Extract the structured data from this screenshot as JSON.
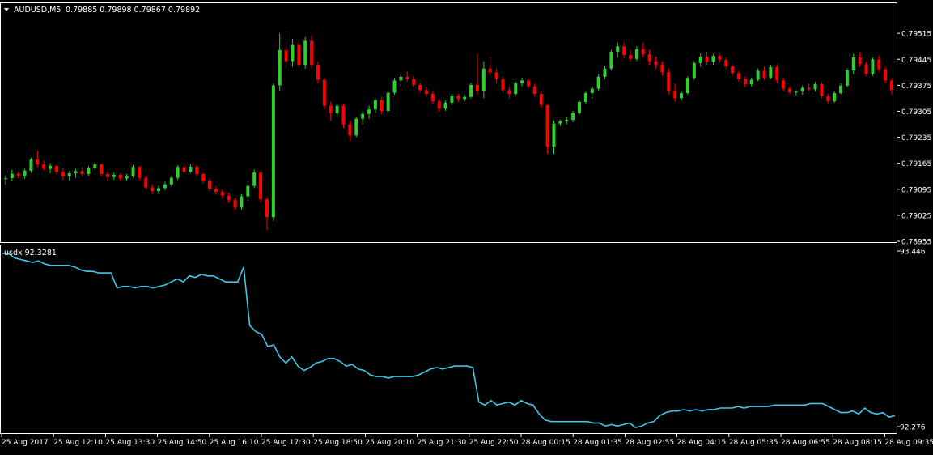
{
  "window": {
    "symbol_label": "AUDUSD,M5",
    "quote_values": "0.79885 0.79898 0.79867 0.79892",
    "indicator_label": "usdx 92.3281",
    "menu_icon": "triangle-down-icon"
  },
  "colors": {
    "background": "#000000",
    "frame": "#ffffff",
    "bull_candle": "#32cd32",
    "bear_candle": "#ff0000",
    "indicator_line": "#40c8e6",
    "text": "#ffffff"
  },
  "chart_data": [
    {
      "type": "candlestick",
      "name": "AUDUSD,M5",
      "y_ticks": [
        "0.79515",
        "0.79445",
        "0.79375",
        "0.79305",
        "0.79235",
        "0.79165",
        "0.79095",
        "0.79025",
        "0.78955"
      ],
      "ylim": [
        0.78955,
        0.79535
      ],
      "grid": false,
      "ohlc": [
        [
          0.79124,
          0.79132,
          0.79108,
          0.79125
        ],
        [
          0.79125,
          0.79148,
          0.79118,
          0.79137
        ],
        [
          0.79137,
          0.79142,
          0.79125,
          0.79131
        ],
        [
          0.79131,
          0.7915,
          0.79124,
          0.79145
        ],
        [
          0.79145,
          0.7918,
          0.7914,
          0.79175
        ],
        [
          0.79175,
          0.79198,
          0.79155,
          0.79162
        ],
        [
          0.79162,
          0.79172,
          0.79145,
          0.7915
        ],
        [
          0.7915,
          0.79165,
          0.79138,
          0.79158
        ],
        [
          0.79158,
          0.7916,
          0.79136,
          0.79142
        ],
        [
          0.79142,
          0.79152,
          0.7912,
          0.7913
        ],
        [
          0.7913,
          0.79144,
          0.79118,
          0.79138
        ],
        [
          0.79138,
          0.7915,
          0.79126,
          0.79144
        ],
        [
          0.79144,
          0.79154,
          0.7913,
          0.79136
        ],
        [
          0.79136,
          0.79158,
          0.7913,
          0.79152
        ],
        [
          0.79152,
          0.79168,
          0.79146,
          0.79162
        ],
        [
          0.79162,
          0.79166,
          0.7913,
          0.79136
        ],
        [
          0.79136,
          0.79142,
          0.79116,
          0.79128
        ],
        [
          0.79128,
          0.7914,
          0.7912,
          0.79134
        ],
        [
          0.79134,
          0.79138,
          0.79118,
          0.79124
        ],
        [
          0.79124,
          0.79136,
          0.79118,
          0.7913
        ],
        [
          0.7913,
          0.7916,
          0.79126,
          0.79155
        ],
        [
          0.79155,
          0.79158,
          0.7912,
          0.79126
        ],
        [
          0.79126,
          0.7913,
          0.79095,
          0.791
        ],
        [
          0.791,
          0.79108,
          0.79082,
          0.7909
        ],
        [
          0.7909,
          0.79105,
          0.79082,
          0.79098
        ],
        [
          0.79098,
          0.79115,
          0.79092,
          0.79108
        ],
        [
          0.79108,
          0.7913,
          0.79102,
          0.79126
        ],
        [
          0.79126,
          0.7916,
          0.7912,
          0.79155
        ],
        [
          0.79155,
          0.79168,
          0.79135,
          0.79142
        ],
        [
          0.79142,
          0.79162,
          0.79138,
          0.79156
        ],
        [
          0.79156,
          0.7916,
          0.7913,
          0.79136
        ],
        [
          0.79136,
          0.7914,
          0.7911,
          0.79118
        ],
        [
          0.79118,
          0.79124,
          0.7909,
          0.79096
        ],
        [
          0.79096,
          0.79104,
          0.7908,
          0.79088
        ],
        [
          0.79088,
          0.79094,
          0.7907,
          0.79078
        ],
        [
          0.79078,
          0.79086,
          0.79058,
          0.79066
        ],
        [
          0.79066,
          0.79072,
          0.7904,
          0.79046
        ],
        [
          0.79046,
          0.79082,
          0.7904,
          0.79076
        ],
        [
          0.79076,
          0.7911,
          0.7907,
          0.79104
        ],
        [
          0.79104,
          0.79148,
          0.79098,
          0.7914
        ],
        [
          0.7914,
          0.79145,
          0.7906,
          0.79068
        ],
        [
          0.79068,
          0.79074,
          0.78985,
          0.7902
        ],
        [
          0.7902,
          0.7938,
          0.7901,
          0.79375
        ],
        [
          0.79375,
          0.79515,
          0.7936,
          0.7947
        ],
        [
          0.7947,
          0.7952,
          0.7942,
          0.7944
        ],
        [
          0.7944,
          0.795,
          0.79425,
          0.79485
        ],
        [
          0.79485,
          0.795,
          0.7942,
          0.7943
        ],
        [
          0.7943,
          0.79505,
          0.7942,
          0.79495
        ],
        [
          0.79495,
          0.7951,
          0.7942,
          0.7943
        ],
        [
          0.7943,
          0.7944,
          0.7938,
          0.7939
        ],
        [
          0.7939,
          0.79395,
          0.7931,
          0.7932
        ],
        [
          0.7932,
          0.7933,
          0.7928,
          0.793
        ],
        [
          0.793,
          0.79325,
          0.7929,
          0.7932
        ],
        [
          0.7932,
          0.79325,
          0.7926,
          0.7927
        ],
        [
          0.7927,
          0.7928,
          0.79225,
          0.7924
        ],
        [
          0.7924,
          0.7929,
          0.79236,
          0.79285
        ],
        [
          0.79285,
          0.79305,
          0.7927,
          0.79298
        ],
        [
          0.79298,
          0.7932,
          0.79285,
          0.7931
        ],
        [
          0.7931,
          0.7934,
          0.793,
          0.79335
        ],
        [
          0.79335,
          0.79345,
          0.79296,
          0.79306
        ],
        [
          0.79306,
          0.7936,
          0.793,
          0.79355
        ],
        [
          0.79355,
          0.79395,
          0.7935,
          0.79388
        ],
        [
          0.79388,
          0.79405,
          0.79372,
          0.79398
        ],
        [
          0.79398,
          0.79412,
          0.79385,
          0.79392
        ],
        [
          0.79392,
          0.794,
          0.7937,
          0.79376
        ],
        [
          0.79376,
          0.79382,
          0.79355,
          0.79362
        ],
        [
          0.79362,
          0.7937,
          0.79345,
          0.79352
        ],
        [
          0.79352,
          0.79358,
          0.79325,
          0.79332
        ],
        [
          0.79332,
          0.79338,
          0.79305,
          0.79312
        ],
        [
          0.79312,
          0.79334,
          0.79306,
          0.79328
        ],
        [
          0.79328,
          0.79352,
          0.79322,
          0.79346
        ],
        [
          0.79346,
          0.79352,
          0.7933,
          0.79338
        ],
        [
          0.79338,
          0.7935,
          0.79332,
          0.79344
        ],
        [
          0.79344,
          0.79382,
          0.7934,
          0.79376
        ],
        [
          0.79376,
          0.7946,
          0.7935,
          0.7936
        ],
        [
          0.7936,
          0.7944,
          0.7934,
          0.7942
        ],
        [
          0.7942,
          0.7945,
          0.794,
          0.7941
        ],
        [
          0.7941,
          0.7942,
          0.7938,
          0.79392
        ],
        [
          0.79392,
          0.79398,
          0.79355,
          0.79362
        ],
        [
          0.79362,
          0.79372,
          0.7934,
          0.79352
        ],
        [
          0.79352,
          0.79385,
          0.79348,
          0.7938
        ],
        [
          0.7938,
          0.79395,
          0.79372,
          0.79388
        ],
        [
          0.79388,
          0.79394,
          0.79366,
          0.79372
        ],
        [
          0.79372,
          0.7938,
          0.79345,
          0.79352
        ],
        [
          0.79352,
          0.79358,
          0.79315,
          0.79322
        ],
        [
          0.79322,
          0.7927,
          0.7919,
          0.7921
        ],
        [
          0.7921,
          0.7928,
          0.7919,
          0.79272
        ],
        [
          0.79272,
          0.79282,
          0.79266,
          0.79278
        ],
        [
          0.79278,
          0.7929,
          0.7927,
          0.79282
        ],
        [
          0.79282,
          0.79306,
          0.79276,
          0.793
        ],
        [
          0.793,
          0.79335,
          0.79296,
          0.7933
        ],
        [
          0.7933,
          0.7936,
          0.79326,
          0.79354
        ],
        [
          0.79354,
          0.79372,
          0.7934,
          0.79366
        ],
        [
          0.79366,
          0.79405,
          0.7936,
          0.79398
        ],
        [
          0.79398,
          0.79428,
          0.79392,
          0.7942
        ],
        [
          0.7942,
          0.7947,
          0.79415,
          0.79465
        ],
        [
          0.79465,
          0.7949,
          0.7945,
          0.7948
        ],
        [
          0.7948,
          0.7949,
          0.79448,
          0.79456
        ],
        [
          0.79456,
          0.7947,
          0.7944,
          0.79446
        ],
        [
          0.79446,
          0.7948,
          0.7944,
          0.79472
        ],
        [
          0.79472,
          0.7949,
          0.7945,
          0.79458
        ],
        [
          0.79458,
          0.7947,
          0.7943,
          0.7944
        ],
        [
          0.7944,
          0.79452,
          0.7942,
          0.7943
        ],
        [
          0.7943,
          0.7944,
          0.794,
          0.7941
        ],
        [
          0.7941,
          0.7942,
          0.7935,
          0.7936
        ],
        [
          0.7936,
          0.7938,
          0.7933,
          0.7934
        ],
        [
          0.7934,
          0.7936,
          0.79334,
          0.79354
        ],
        [
          0.79354,
          0.794,
          0.7935,
          0.79395
        ],
        [
          0.79395,
          0.7944,
          0.7939,
          0.79435
        ],
        [
          0.79435,
          0.7946,
          0.79425,
          0.79452
        ],
        [
          0.79452,
          0.79465,
          0.7943,
          0.79438
        ],
        [
          0.79438,
          0.7946,
          0.7943,
          0.79454
        ],
        [
          0.79454,
          0.79462,
          0.79436,
          0.79444
        ],
        [
          0.79444,
          0.7945,
          0.7942,
          0.79426
        ],
        [
          0.79426,
          0.79432,
          0.794,
          0.79408
        ],
        [
          0.79408,
          0.79414,
          0.79385,
          0.79392
        ],
        [
          0.79392,
          0.79398,
          0.7937,
          0.79378
        ],
        [
          0.79378,
          0.79396,
          0.79372,
          0.7939
        ],
        [
          0.7939,
          0.7942,
          0.79386,
          0.79414
        ],
        [
          0.79414,
          0.79425,
          0.7939,
          0.79396
        ],
        [
          0.79396,
          0.7943,
          0.79392,
          0.79424
        ],
        [
          0.79424,
          0.79432,
          0.7938,
          0.79388
        ],
        [
          0.79388,
          0.79395,
          0.7936,
          0.79366
        ],
        [
          0.79366,
          0.79372,
          0.7935,
          0.79356
        ],
        [
          0.79356,
          0.79362,
          0.79348,
          0.79358
        ],
        [
          0.79358,
          0.79374,
          0.7935,
          0.79368
        ],
        [
          0.79368,
          0.7938,
          0.79358,
          0.79364
        ],
        [
          0.79364,
          0.79384,
          0.79358,
          0.79378
        ],
        [
          0.79378,
          0.79384,
          0.7934,
          0.79346
        ],
        [
          0.79346,
          0.79352,
          0.79325,
          0.79332
        ],
        [
          0.79332,
          0.7936,
          0.79328,
          0.79354
        ],
        [
          0.79354,
          0.7938,
          0.7935,
          0.79374
        ],
        [
          0.79374,
          0.7942,
          0.7937,
          0.79415
        ],
        [
          0.79415,
          0.7946,
          0.79405,
          0.7945
        ],
        [
          0.7945,
          0.79465,
          0.79425,
          0.79432
        ],
        [
          0.79432,
          0.79438,
          0.794,
          0.79406
        ],
        [
          0.79406,
          0.7945,
          0.794,
          0.79445
        ],
        [
          0.79445,
          0.79455,
          0.7941,
          0.79418
        ],
        [
          0.79418,
          0.79425,
          0.7938,
          0.79388
        ],
        [
          0.79388,
          0.79394,
          0.7935,
          0.79362
        ]
      ]
    },
    {
      "type": "line",
      "name": "usdx",
      "ylim": [
        92.276,
        93.446
      ],
      "y_ticks": [
        "93.446",
        "92.276"
      ],
      "x_ticks": [
        "25 Aug 2017",
        "25 Aug 12:10",
        "25 Aug 13:30",
        "25 Aug 14:50",
        "25 Aug 16:10",
        "25 Aug 17:30",
        "25 Aug 18:50",
        "25 Aug 20:10",
        "25 Aug 21:30",
        "25 Aug 22:50",
        "28 Aug 00:15",
        "28 Aug 01:35",
        "28 Aug 02:55",
        "28 Aug 04:15",
        "28 Aug 05:35",
        "28 Aug 06:55",
        "28 Aug 08:15",
        "28 Aug 09:35"
      ],
      "grid": false,
      "values": [
        93.43,
        93.43,
        93.4,
        93.39,
        93.38,
        93.37,
        93.38,
        93.36,
        93.35,
        93.35,
        93.35,
        93.35,
        93.34,
        93.32,
        93.31,
        93.31,
        93.3,
        93.3,
        93.3,
        93.2,
        93.21,
        93.21,
        93.2,
        93.21,
        93.21,
        93.2,
        93.21,
        93.22,
        93.24,
        93.26,
        93.24,
        93.28,
        93.27,
        93.29,
        93.28,
        93.28,
        93.26,
        93.24,
        93.24,
        93.24,
        93.34,
        92.95,
        92.91,
        92.89,
        92.81,
        92.82,
        92.74,
        92.7,
        92.74,
        92.68,
        92.65,
        92.67,
        92.7,
        92.71,
        92.73,
        92.73,
        92.71,
        92.68,
        92.69,
        92.66,
        92.65,
        92.62,
        92.61,
        92.61,
        92.6,
        92.61,
        92.61,
        92.61,
        92.61,
        92.62,
        92.64,
        92.66,
        92.67,
        92.66,
        92.67,
        92.68,
        92.68,
        92.68,
        92.67,
        92.44,
        92.42,
        92.45,
        92.42,
        92.43,
        92.44,
        92.42,
        92.45,
        92.43,
        92.42,
        92.36,
        92.32,
        92.31,
        92.31,
        92.31,
        92.31,
        92.31,
        92.31,
        92.31,
        92.3,
        92.3,
        92.28,
        92.29,
        92.28,
        92.29,
        92.3,
        92.27,
        92.28,
        92.3,
        92.31,
        92.35,
        92.37,
        92.38,
        92.38,
        92.39,
        92.38,
        92.39,
        92.38,
        92.39,
        92.39,
        92.4,
        92.4,
        92.4,
        92.41,
        92.4,
        92.41,
        92.41,
        92.41,
        92.41,
        92.42,
        92.42,
        92.42,
        92.42,
        92.42,
        92.42,
        92.43,
        92.43,
        92.43,
        92.41,
        92.39,
        92.37,
        92.37,
        92.38,
        92.36,
        92.4,
        92.37,
        92.36,
        92.37,
        92.34,
        92.35
      ]
    }
  ]
}
